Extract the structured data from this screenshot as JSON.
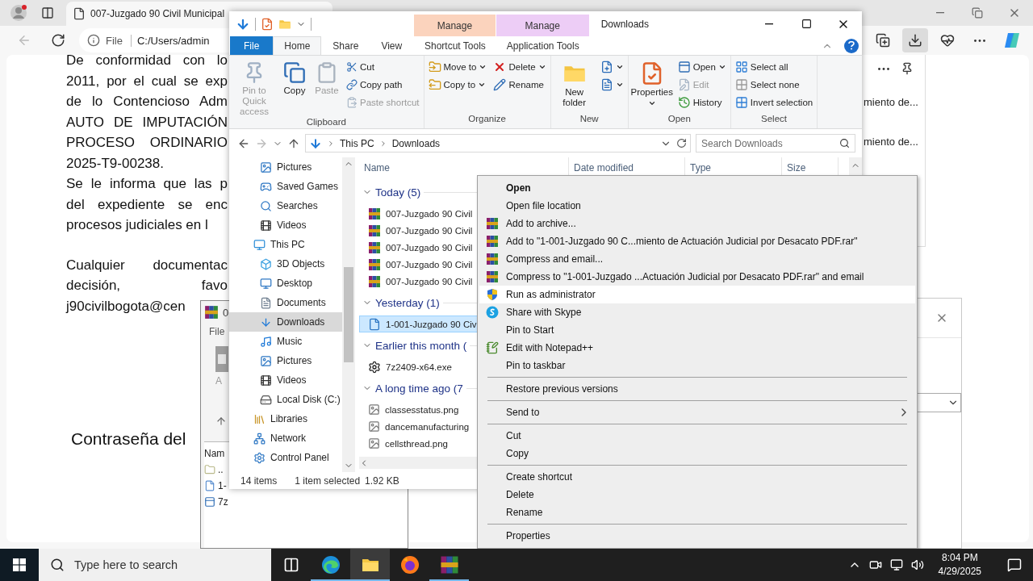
{
  "browser": {
    "tab_title": "007-Juzgado 90 Civil Municipal",
    "address_scheme": "File",
    "address": "C:/Users/admin",
    "document_paragraphs": [
      [
        "De conformidad con lo",
        "2011, por el cual se exp",
        "de lo Contencioso Adm",
        "AUTO DE IMPUTACIÓN",
        "PROCESO ORDINARIO",
        "2025-T9-00238.",
        "Se le informa que las p",
        "del expediente se enc",
        "procesos judiciales en l"
      ],
      [
        "Cualquier documentac",
        "decisión, favo",
        "j90civilbogota@cen"
      ]
    ],
    "password_label": "Contraseña del",
    "downloads_panel": [
      "miento de...",
      "miento de..."
    ]
  },
  "archive_window": {
    "title": "0",
    "menu": "File",
    "toolbar_label": "A",
    "column": "Nam",
    "rows": [
      "..",
      "1-",
      "7z"
    ]
  },
  "explorer": {
    "title": "Downloads",
    "tabs": [
      {
        "label": "File",
        "kind": "file",
        "selected": false
      },
      {
        "label": "Home",
        "kind": "tab",
        "selected": true
      },
      {
        "label": "Share",
        "kind": "tab",
        "selected": false
      },
      {
        "label": "View",
        "kind": "tab",
        "selected": false
      }
    ],
    "context_tabs": [
      {
        "group": "Manage",
        "label": "Shortcut Tools",
        "color": "#fbd3bd",
        "selected": false
      },
      {
        "group": "Manage",
        "label": "Application Tools",
        "color": "#edcdf6",
        "selected": false
      }
    ],
    "ribbon": [
      {
        "name": "Clipboard",
        "columns": [
          [
            {
              "label": "Pin to Quick access",
              "kind": "large",
              "disabled": true,
              "dropdown": false
            }
          ],
          [
            {
              "label": "Copy",
              "kind": "large",
              "disabled": false,
              "dropdown": false
            }
          ],
          [
            {
              "label": "Paste",
              "kind": "large",
              "disabled": true,
              "dropdown": false
            }
          ],
          [
            {
              "label": "Cut",
              "kind": "small",
              "disabled": false,
              "dropdown": false
            },
            {
              "label": "Copy path",
              "kind": "small",
              "disabled": false,
              "dropdown": false
            },
            {
              "label": "Paste shortcut",
              "kind": "small",
              "disabled": true,
              "dropdown": false
            }
          ]
        ]
      },
      {
        "name": "Organize",
        "columns": [
          [
            {
              "label": "Move to",
              "kind": "small",
              "disabled": false,
              "dropdown": true
            },
            {
              "label": "Copy to",
              "kind": "small",
              "disabled": false,
              "dropdown": true
            }
          ],
          [
            {
              "label": "Delete",
              "kind": "small",
              "disabled": false,
              "dropdown": true
            },
            {
              "label": "Rename",
              "kind": "small",
              "disabled": false,
              "dropdown": false
            }
          ]
        ]
      },
      {
        "name": "New",
        "columns": [
          [
            {
              "label": "New folder",
              "kind": "large",
              "disabled": false,
              "dropdown": false
            }
          ],
          [
            {
              "kind": "icon",
              "disabled": false,
              "dropdown": true
            },
            {
              "kind": "icon",
              "disabled": false,
              "dropdown": true
            }
          ]
        ]
      },
      {
        "name": "Open",
        "columns": [
          [
            {
              "label": "Properties",
              "kind": "large",
              "disabled": false,
              "dropdown": true
            }
          ],
          [
            {
              "label": "Open",
              "kind": "small",
              "disabled": false,
              "dropdown": true
            },
            {
              "label": "Edit",
              "kind": "small",
              "disabled": true,
              "dropdown": false
            },
            {
              "label": "History",
              "kind": "small",
              "disabled": false,
              "dropdown": false
            }
          ]
        ]
      },
      {
        "name": "Select",
        "columns": [
          [
            {
              "label": "Select all",
              "kind": "small",
              "disabled": false,
              "dropdown": false
            },
            {
              "label": "Select none",
              "kind": "small",
              "disabled": false,
              "dropdown": false
            },
            {
              "label": "Invert selection",
              "kind": "small",
              "disabled": false,
              "dropdown": false
            }
          ]
        ]
      }
    ],
    "breadcrumb": [
      "This PC",
      "Downloads"
    ],
    "search_placeholder": "Search Downloads",
    "nav": {
      "above": [
        {
          "label": "Pictures",
          "selected": false
        },
        {
          "label": "Saved Games",
          "selected": false
        },
        {
          "label": "Searches",
          "selected": false
        },
        {
          "label": "Videos",
          "selected": false
        }
      ],
      "tree": [
        {
          "label": "This PC",
          "selected": false,
          "children": [
            {
              "label": "3D Objects",
              "selected": false
            },
            {
              "label": "Desktop",
              "selected": false
            },
            {
              "label": "Documents",
              "selected": false
            },
            {
              "label": "Downloads",
              "selected": true
            },
            {
              "label": "Music",
              "selected": false
            },
            {
              "label": "Pictures",
              "selected": false
            },
            {
              "label": "Videos",
              "selected": false
            },
            {
              "label": "Local Disk (C:)",
              "selected": false
            }
          ]
        },
        {
          "label": "Libraries",
          "selected": false
        },
        {
          "label": "Network",
          "selected": false
        },
        {
          "label": "Control Panel",
          "selected": false
        }
      ]
    },
    "columns": [
      "Name",
      "Date modified",
      "Type",
      "Size"
    ],
    "groups": [
      {
        "label": "Today (5)",
        "expanded": true,
        "files": [
          {
            "name": "007-Juzgado 90 Civil",
            "selected": false
          },
          {
            "name": "007-Juzgado 90 Civil",
            "selected": false
          },
          {
            "name": "007-Juzgado 90 Civil",
            "selected": false
          },
          {
            "name": "007-Juzgado 90 Civil",
            "selected": false
          },
          {
            "name": "007-Juzgado 90 Civil",
            "selected": false
          }
        ]
      },
      {
        "label": "Yesterday (1)",
        "expanded": true,
        "files": [
          {
            "name": "1-001-Juzgado 90 Civ",
            "selected": true
          }
        ]
      },
      {
        "label": "Earlier this month (",
        "expanded": true,
        "files": [
          {
            "name": "7z2409-x64.exe",
            "selected": false
          }
        ]
      },
      {
        "label": "A long time ago (7",
        "expanded": true,
        "files": [
          {
            "name": "classesstatus.png",
            "selected": false
          },
          {
            "name": "dancemanufacturing",
            "selected": false
          },
          {
            "name": "cellsthread.png",
            "selected": false
          }
        ]
      }
    ],
    "status": [
      "14 items",
      "1 item selected",
      "1.92 KB"
    ]
  },
  "context_menu": [
    {
      "kind": "item",
      "label": "Open",
      "default": true,
      "selected": false,
      "submenu": false
    },
    {
      "kind": "item",
      "label": "Open file location",
      "default": false,
      "selected": false,
      "submenu": false
    },
    {
      "kind": "item",
      "label": "Add to archive...",
      "default": false,
      "selected": false,
      "submenu": false
    },
    {
      "kind": "item",
      "label": "Add to \"1-001-Juzgado 90 C...miento de Actuación Judicial por Desacato PDF.rar\"",
      "default": false,
      "selected": false,
      "submenu": false
    },
    {
      "kind": "item",
      "label": "Compress and email...",
      "default": false,
      "selected": false,
      "submenu": false
    },
    {
      "kind": "item",
      "label": "Compress to \"1-001-Juzgado ...Actuación Judicial por Desacato PDF.rar\" and email",
      "default": false,
      "selected": false,
      "submenu": false
    },
    {
      "kind": "item",
      "label": "Run as administrator",
      "default": false,
      "selected": true,
      "submenu": false
    },
    {
      "kind": "item",
      "label": "Share with Skype",
      "default": false,
      "selected": false,
      "submenu": false
    },
    {
      "kind": "item",
      "label": "Pin to Start",
      "default": false,
      "selected": false,
      "submenu": false
    },
    {
      "kind": "item",
      "label": "Edit with Notepad++",
      "default": false,
      "selected": false,
      "submenu": false
    },
    {
      "kind": "item",
      "label": "Pin to taskbar",
      "default": false,
      "selected": false,
      "submenu": false
    },
    {
      "kind": "separator"
    },
    {
      "kind": "item",
      "label": "Restore previous versions",
      "default": false,
      "selected": false,
      "submenu": false
    },
    {
      "kind": "separator"
    },
    {
      "kind": "item",
      "label": "Send to",
      "default": false,
      "selected": false,
      "submenu": true
    },
    {
      "kind": "separator"
    },
    {
      "kind": "item",
      "label": "Cut",
      "default": false,
      "selected": false,
      "submenu": false
    },
    {
      "kind": "item",
      "label": "Copy",
      "default": false,
      "selected": false,
      "submenu": false
    },
    {
      "kind": "separator"
    },
    {
      "kind": "item",
      "label": "Create shortcut",
      "default": false,
      "selected": false,
      "submenu": false
    },
    {
      "kind": "item",
      "label": "Delete",
      "default": false,
      "selected": false,
      "submenu": false
    },
    {
      "kind": "item",
      "label": "Rename",
      "default": false,
      "selected": false,
      "submenu": false
    },
    {
      "kind": "separator"
    },
    {
      "kind": "item",
      "label": "Properties",
      "default": false,
      "selected": false,
      "submenu": false
    }
  ],
  "taskbar": {
    "search_placeholder": "Type here to search",
    "apps": [
      {
        "active": false,
        "running": true
      },
      {
        "active": true,
        "running": true
      },
      {
        "active": false,
        "running": false
      },
      {
        "active": false,
        "running": true
      }
    ],
    "time": "8:04 PM",
    "date": "4/29/2025"
  }
}
